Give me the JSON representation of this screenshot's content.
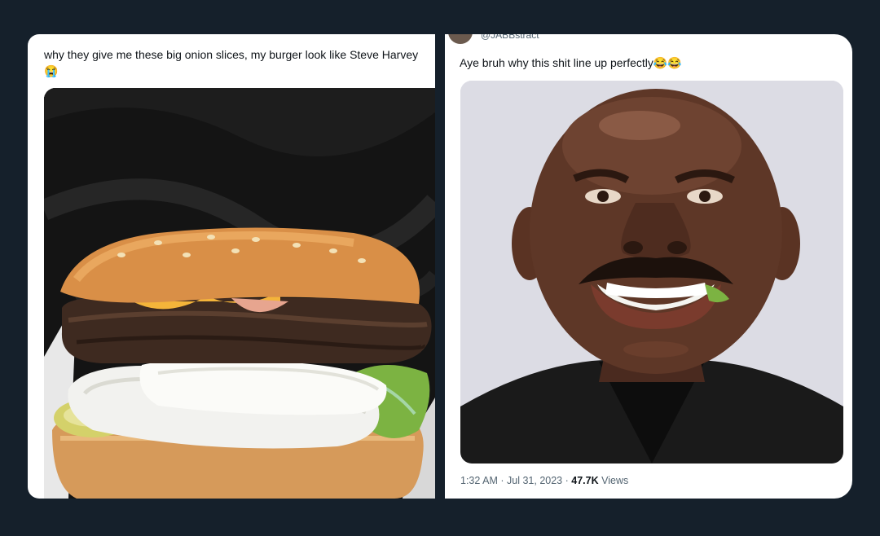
{
  "left_tweet": {
    "text": "why they give me these big onion slices, my burger look like Steve Harvey",
    "emoji": "😭"
  },
  "right_tweet": {
    "handle": "@JABBstract",
    "text": "Aye bruh why this shit line up perfectly",
    "emoji": "😂😂",
    "time": "1:32 AM",
    "date": "Jul 31, 2023",
    "views_count": "47.7K",
    "views_label": "Views",
    "separator": "·"
  },
  "colors": {
    "background": "#15202b",
    "card": "#ffffff",
    "text": "#0f1419",
    "muted": "#536471"
  }
}
